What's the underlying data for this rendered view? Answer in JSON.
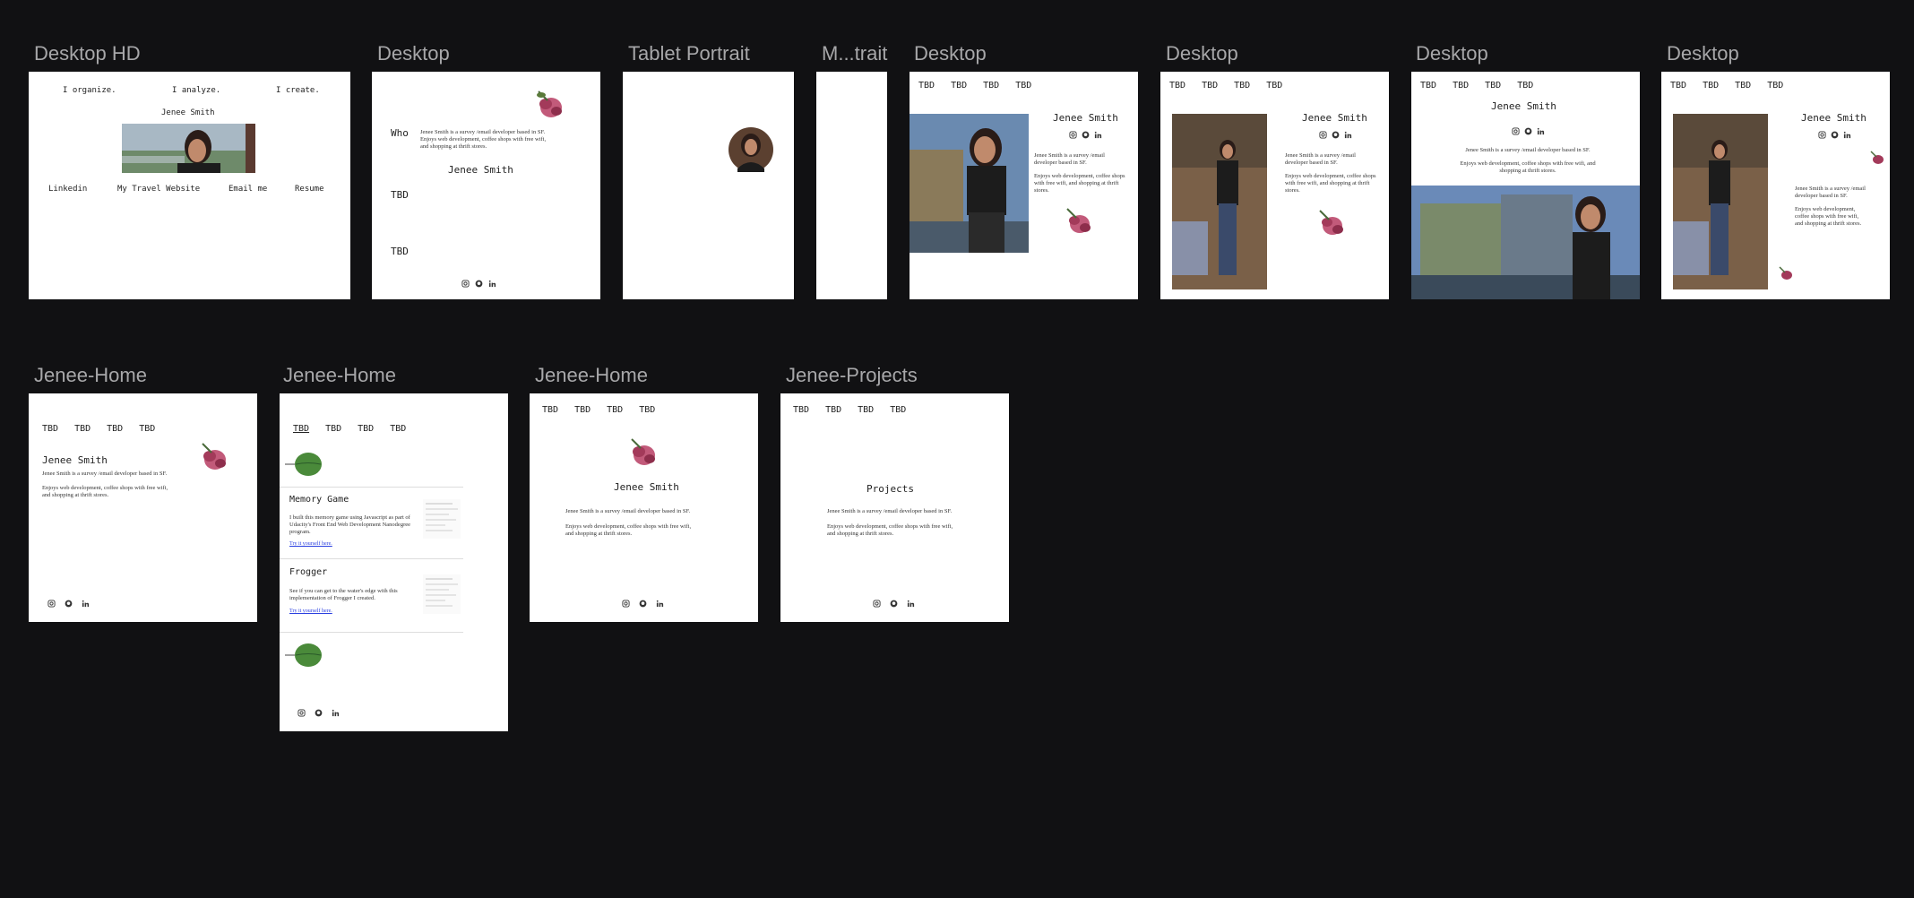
{
  "labels": {
    "f1": "Desktop HD",
    "f2": "Desktop",
    "f3": "Tablet Portrait",
    "f4": "M...trait",
    "f5": "Desktop",
    "f6": "Desktop",
    "f7": "Desktop",
    "f8": "Desktop",
    "f9": "Jenee-Home",
    "f10": "Jenee-Home",
    "f11": "Jenee-Home",
    "f12": "Jenee-Projects"
  },
  "name": "Jenee Smith",
  "hd": {
    "top": [
      "I organize.",
      "I analyze.",
      "I create."
    ],
    "bottom": [
      "Linkedin",
      "My Travel Website",
      "Email me",
      "Resume"
    ]
  },
  "who": "Who",
  "tbd": "TBD",
  "nav": [
    "TBD",
    "TBD",
    "TBD",
    "TBD"
  ],
  "bio1": "Jenee Smith is a survey /email developer based in SF.",
  "bio2": "Enjoys web development, coffee shops with free wifi, and shopping at thrift stores.",
  "bio_short": "Jenee Smith is a survey /email developer based in SF.",
  "projects_title": "Projects",
  "memory": {
    "title": "Memory Game",
    "desc": "I built this memory game using Javascript as part of Udacity's Front End Web Development Nanodegree program.",
    "link": "Try it yourself here."
  },
  "frogger": {
    "title": "Frogger",
    "desc": "See if you can get to the water's edge with this implementation of Frogger I created.",
    "link": "Try it yourself here."
  },
  "icons": [
    "instagram-icon",
    "github-icon",
    "linkedin-icon"
  ],
  "colors": {
    "canvas": "#111113",
    "label": "#a7a7a9",
    "link": "#2a3fe0"
  }
}
